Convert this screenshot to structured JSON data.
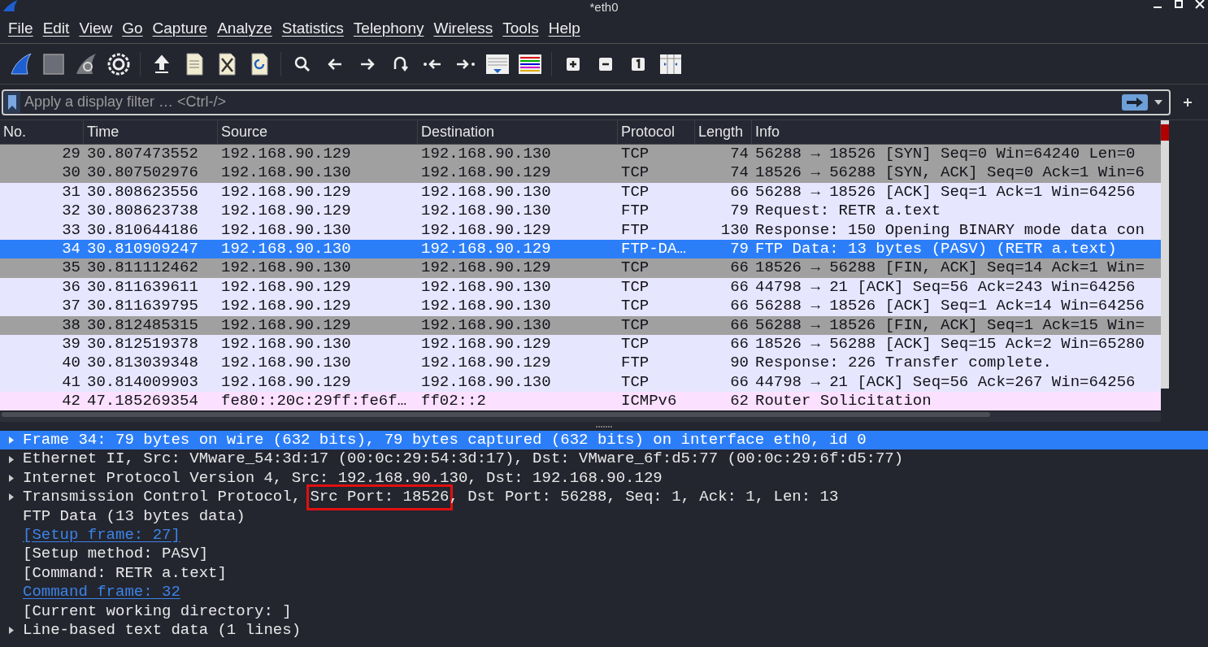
{
  "window": {
    "title": "*eth0"
  },
  "menu": [
    {
      "label": "File"
    },
    {
      "label": "Edit"
    },
    {
      "label": "View"
    },
    {
      "label": "Go"
    },
    {
      "label": "Capture"
    },
    {
      "label": "Analyze"
    },
    {
      "label": "Statistics"
    },
    {
      "label": "Telephony"
    },
    {
      "label": "Wireless"
    },
    {
      "label": "Tools"
    },
    {
      "label": "Help"
    }
  ],
  "toolbar": [
    {
      "kind": "fin"
    },
    {
      "kind": "stop"
    },
    {
      "kind": "restart"
    },
    {
      "kind": "gear"
    },
    {
      "kind": "separator"
    },
    {
      "kind": "upload"
    },
    {
      "kind": "file"
    },
    {
      "kind": "closefile"
    },
    {
      "kind": "reload"
    },
    {
      "kind": "separator"
    },
    {
      "kind": "search"
    },
    {
      "kind": "back"
    },
    {
      "kind": "forward"
    },
    {
      "kind": "jump"
    },
    {
      "kind": "first"
    },
    {
      "kind": "last"
    },
    {
      "kind": "autoscroll"
    },
    {
      "kind": "colorize"
    },
    {
      "kind": "separator"
    },
    {
      "kind": "zoomin"
    },
    {
      "kind": "zoomout"
    },
    {
      "kind": "normal"
    },
    {
      "kind": "resize"
    }
  ],
  "filter": {
    "placeholder": "Apply a display filter … <Ctrl-/>"
  },
  "packet_list": {
    "columns": [
      "No.",
      "Time",
      "Source",
      "Destination",
      "Protocol",
      "Length",
      "Info"
    ],
    "rows": [
      {
        "no": "29",
        "time": "30.807473552",
        "source": "192.168.90.129",
        "destination": "192.168.90.130",
        "protocol": "TCP",
        "length": "74",
        "info": "56288 → 18526 [SYN] Seq=0 Win=64240 Len=0",
        "color": "#a0a0a0",
        "selected": false
      },
      {
        "no": "30",
        "time": "30.807502976",
        "source": "192.168.90.130",
        "destination": "192.168.90.129",
        "protocol": "TCP",
        "length": "74",
        "info": "18526 → 56288 [SYN, ACK] Seq=0 Ack=1 Win=6",
        "color": "#a0a0a0",
        "selected": false
      },
      {
        "no": "31",
        "time": "30.808623556",
        "source": "192.168.90.129",
        "destination": "192.168.90.130",
        "protocol": "TCP",
        "length": "66",
        "info": "56288 → 18526 [ACK] Seq=1 Ack=1 Win=64256",
        "color": "#e7e6ff",
        "selected": false
      },
      {
        "no": "32",
        "time": "30.808623738",
        "source": "192.168.90.129",
        "destination": "192.168.90.130",
        "protocol": "FTP",
        "length": "79",
        "info": "Request: RETR a.text",
        "color": "#e7e6ff",
        "selected": false
      },
      {
        "no": "33",
        "time": "30.810644186",
        "source": "192.168.90.130",
        "destination": "192.168.90.129",
        "protocol": "FTP",
        "length": "130",
        "info": "Response: 150 Opening BINARY mode data con",
        "color": "#e7e6ff",
        "selected": false
      },
      {
        "no": "34",
        "time": "30.810909247",
        "source": "192.168.90.130",
        "destination": "192.168.90.129",
        "protocol": "FTP-DA…",
        "length": "79",
        "info": "FTP Data: 13 bytes (PASV) (RETR a.text)",
        "selected": true
      },
      {
        "no": "35",
        "time": "30.811112462",
        "source": "192.168.90.130",
        "destination": "192.168.90.129",
        "protocol": "TCP",
        "length": "66",
        "info": "18526 → 56288 [FIN, ACK] Seq=14 Ack=1 Win=",
        "color": "#a0a0a0",
        "selected": false
      },
      {
        "no": "36",
        "time": "30.811639611",
        "source": "192.168.90.129",
        "destination": "192.168.90.130",
        "protocol": "TCP",
        "length": "66",
        "info": "44798 → 21 [ACK] Seq=56 Ack=243 Win=64256",
        "color": "#e7e6ff",
        "selected": false
      },
      {
        "no": "37",
        "time": "30.811639795",
        "source": "192.168.90.129",
        "destination": "192.168.90.130",
        "protocol": "TCP",
        "length": "66",
        "info": "56288 → 18526 [ACK] Seq=1 Ack=14 Win=64256",
        "color": "#e7e6ff",
        "selected": false
      },
      {
        "no": "38",
        "time": "30.812485315",
        "source": "192.168.90.129",
        "destination": "192.168.90.130",
        "protocol": "TCP",
        "length": "66",
        "info": "56288 → 18526 [FIN, ACK] Seq=1 Ack=15 Win=",
        "color": "#a0a0a0",
        "selected": false
      },
      {
        "no": "39",
        "time": "30.812519378",
        "source": "192.168.90.130",
        "destination": "192.168.90.129",
        "protocol": "TCP",
        "length": "66",
        "info": "18526 → 56288 [ACK] Seq=15 Ack=2 Win=65280",
        "color": "#e7e6ff",
        "selected": false
      },
      {
        "no": "40",
        "time": "30.813039348",
        "source": "192.168.90.130",
        "destination": "192.168.90.129",
        "protocol": "FTP",
        "length": "90",
        "info": "Response: 226 Transfer complete.",
        "color": "#e7e6ff",
        "selected": false
      },
      {
        "no": "41",
        "time": "30.814009903",
        "source": "192.168.90.129",
        "destination": "192.168.90.130",
        "protocol": "TCP",
        "length": "66",
        "info": "44798 → 21 [ACK] Seq=56 Ack=267 Win=64256",
        "color": "#e7e6ff",
        "selected": false
      },
      {
        "no": "42",
        "time": "47.185269354",
        "source": "fe80::20c:29ff:fe6f…",
        "destination": "ff02::2",
        "protocol": "ICMPv6",
        "length": "62",
        "info": "Router Solicitation",
        "color": "#fce0ff",
        "selected": false
      }
    ]
  },
  "details": [
    {
      "kind": "text",
      "text": "Frame 34: 79 bytes on wire (632 bits), 79 bytes captured (632 bits) on interface eth0, id 0",
      "expander": true,
      "selected": true
    },
    {
      "kind": "text",
      "text": "Ethernet II, Src: VMware_54:3d:17 (00:0c:29:54:3d:17), Dst: VMware_6f:d5:77 (00:0c:29:6f:d5:77)",
      "expander": true,
      "selected": false
    },
    {
      "kind": "text",
      "text": "Internet Protocol Version 4, Src: 192.168.90.130, Dst: 192.168.90.129",
      "expander": true,
      "selected": false
    },
    {
      "kind": "annotated",
      "parts": [
        {
          "text": "Transmission Control Protocol, ",
          "boxed": false
        },
        {
          "text": "Src Port: 18526",
          "boxed": true
        },
        {
          "text": ", Dst Port: 56288, Seq: 1, Ack: 1, Len: 13",
          "boxed": false
        }
      ],
      "expander": true,
      "selected": false
    },
    {
      "kind": "text",
      "text": "FTP Data (13 bytes data)",
      "expander": false,
      "selected": false
    },
    {
      "kind": "link",
      "text": "[Setup frame: 27]",
      "expander": false,
      "selected": false
    },
    {
      "kind": "text",
      "text": "[Setup method: PASV]",
      "expander": false,
      "selected": false
    },
    {
      "kind": "text",
      "text": "[Command: RETR a.text]",
      "expander": false,
      "selected": false
    },
    {
      "kind": "link",
      "text": "Command frame: 32",
      "expander": false,
      "selected": false
    },
    {
      "kind": "text",
      "text": "[Current working directory: ]",
      "expander": false,
      "selected": false
    },
    {
      "kind": "text",
      "text": "Line-based text data (1 lines)",
      "expander": true,
      "selected": false
    }
  ]
}
